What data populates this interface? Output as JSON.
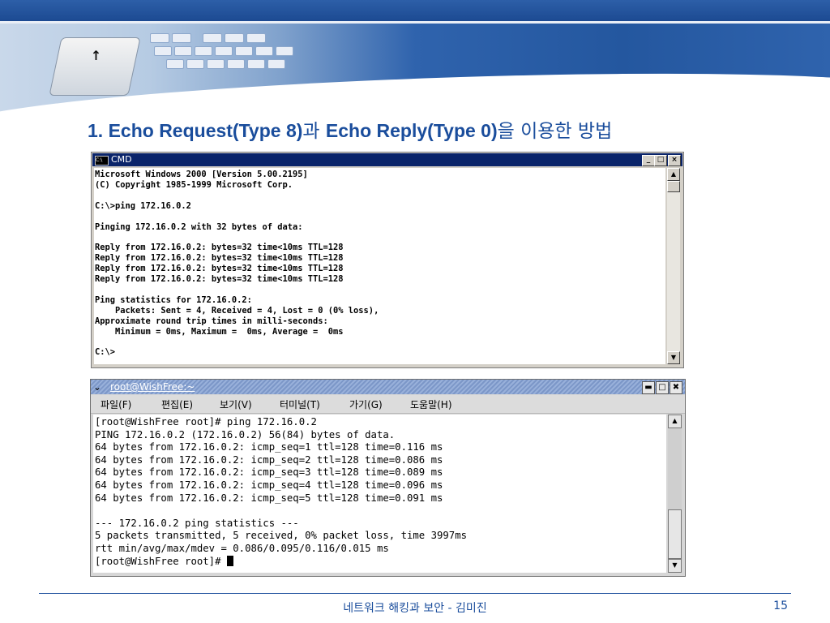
{
  "slide": {
    "title_lead": "1. Echo Request(Type 8)",
    "title_kr1": "과 ",
    "title_mid": "Echo Reply(Type 0)",
    "title_kr2": "을 이용한 방법"
  },
  "cmd_window": {
    "title": "CMD",
    "minimize": "_",
    "maximize": "□",
    "close": "×",
    "scroll_up": "▲",
    "scroll_down": "▼",
    "lines": [
      "Microsoft Windows 2000 [Version 5.00.2195]",
      "(C) Copyright 1985-1999 Microsoft Corp.",
      "",
      "C:\\>ping 172.16.0.2",
      "",
      "Pinging 172.16.0.2 with 32 bytes of data:",
      "",
      "Reply from 172.16.0.2: bytes=32 time<10ms TTL=128",
      "Reply from 172.16.0.2: bytes=32 time<10ms TTL=128",
      "Reply from 172.16.0.2: bytes=32 time<10ms TTL=128",
      "Reply from 172.16.0.2: bytes=32 time<10ms TTL=128",
      "",
      "Ping statistics for 172.16.0.2:",
      "    Packets: Sent = 4, Received = 4, Lost = 0 (0% loss),",
      "Approximate round trip times in milli-seconds:",
      "    Minimum = 0ms, Maximum =  0ms, Average =  0ms",
      "",
      "C:\\>"
    ]
  },
  "terminal_window": {
    "title": "root@WishFree:~",
    "menu_icon": "⌄",
    "minimize": "▬",
    "maximize": "□",
    "close": "✖",
    "scroll_up": "▲",
    "scroll_down": "▼",
    "menu": [
      "파일(F)",
      "편집(E)",
      "보기(V)",
      "터미널(T)",
      "가기(G)",
      "도움말(H)"
    ],
    "lines": [
      "[root@WishFree root]# ping 172.16.0.2",
      "PING 172.16.0.2 (172.16.0.2) 56(84) bytes of data.",
      "64 bytes from 172.16.0.2: icmp_seq=1 ttl=128 time=0.116 ms",
      "64 bytes from 172.16.0.2: icmp_seq=2 ttl=128 time=0.086 ms",
      "64 bytes from 172.16.0.2: icmp_seq=3 ttl=128 time=0.089 ms",
      "64 bytes from 172.16.0.2: icmp_seq=4 ttl=128 time=0.096 ms",
      "64 bytes from 172.16.0.2: icmp_seq=5 ttl=128 time=0.091 ms",
      "",
      "--- 172.16.0.2 ping statistics ---",
      "5 packets transmitted, 5 received, 0% packet loss, time 3997ms",
      "rtt min/avg/max/mdev = 0.086/0.095/0.116/0.015 ms"
    ],
    "prompt": "[root@WishFree root]# "
  },
  "footer": {
    "text": "네트워크 해킹과 보안  -  김미진",
    "page_number": "15"
  },
  "colors": {
    "title_blue": "#1a4d9c",
    "cmd_titlebar": "#0a246a",
    "terminal_titlebar": "#7c97c8"
  }
}
